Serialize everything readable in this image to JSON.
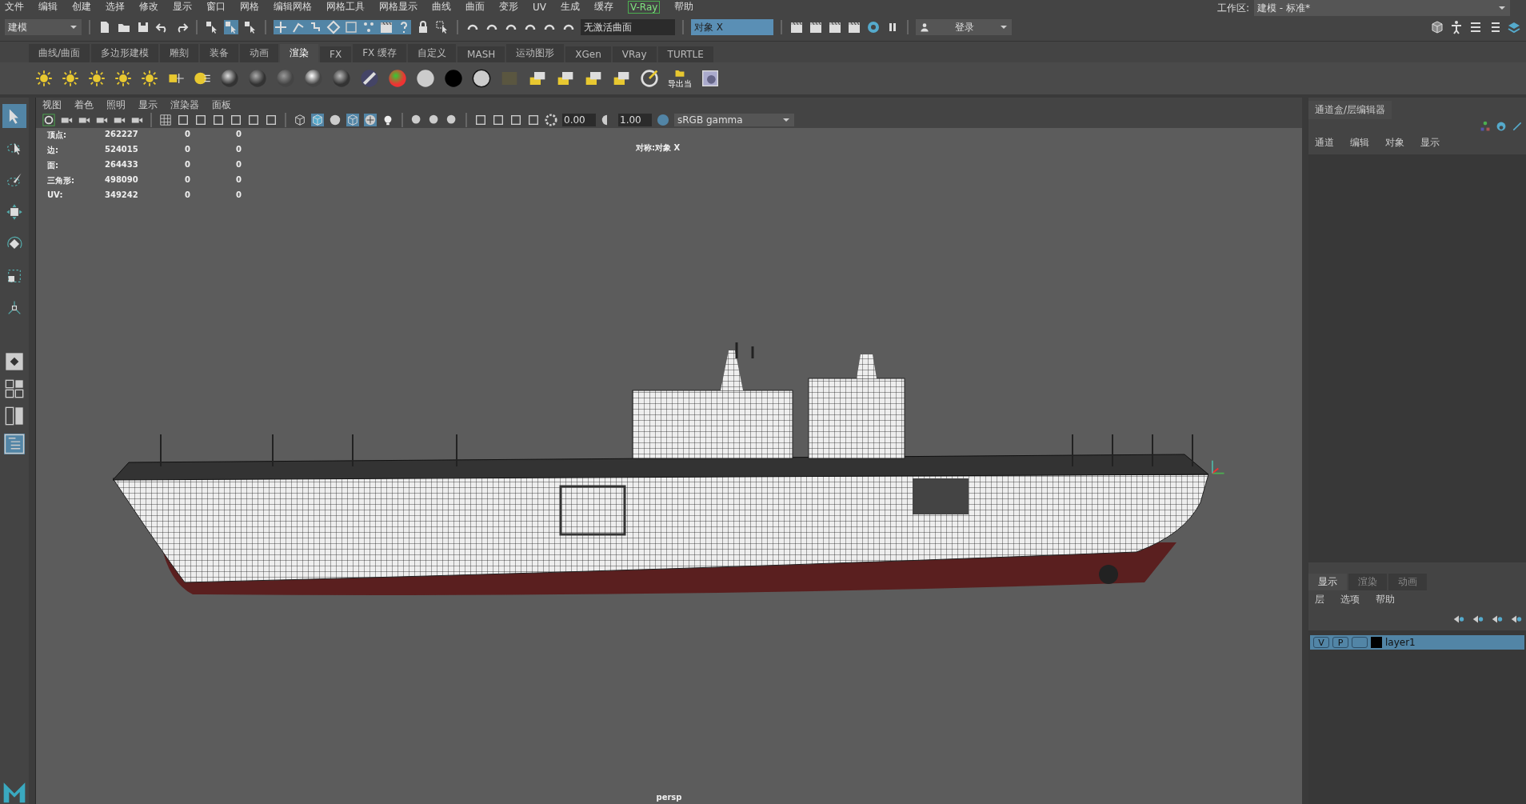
{
  "menu_bar": [
    {
      "label": "文件",
      "highlighted": false
    },
    {
      "label": "编辑",
      "highlighted": false
    },
    {
      "label": "创建",
      "highlighted": false
    },
    {
      "label": "选择",
      "highlighted": false
    },
    {
      "label": "修改",
      "highlighted": false
    },
    {
      "label": "显示",
      "highlighted": false
    },
    {
      "label": "窗口",
      "highlighted": false
    },
    {
      "label": "网格",
      "highlighted": false
    },
    {
      "label": "编辑网格",
      "highlighted": false
    },
    {
      "label": "网格工具",
      "highlighted": false
    },
    {
      "label": "网格显示",
      "highlighted": false
    },
    {
      "label": "曲线",
      "highlighted": false
    },
    {
      "label": "曲面",
      "highlighted": false
    },
    {
      "label": "变形",
      "highlighted": false
    },
    {
      "label": "UV",
      "highlighted": false
    },
    {
      "label": "生成",
      "highlighted": false
    },
    {
      "label": "缓存",
      "highlighted": false
    },
    {
      "label": "V-Ray",
      "highlighted": true
    },
    {
      "label": "帮助",
      "highlighted": false
    }
  ],
  "status_line": {
    "mode": "建模",
    "input_field": "无激活曲面",
    "symmetry": "对象 X",
    "login": "登录",
    "workspace_label": "工作区:",
    "workspace": "建模 - 标准*"
  },
  "shelf": {
    "tabs": [
      {
        "label": "曲线/曲面",
        "selected": false
      },
      {
        "label": "多边形建模",
        "selected": false
      },
      {
        "label": "雕刻",
        "selected": false
      },
      {
        "label": "装备",
        "selected": false
      },
      {
        "label": "动画",
        "selected": false
      },
      {
        "label": "渲染",
        "selected": true
      },
      {
        "label": "FX",
        "selected": false
      },
      {
        "label": "FX 缓存",
        "selected": false
      },
      {
        "label": "自定义",
        "selected": false
      },
      {
        "label": "MASH",
        "selected": false
      },
      {
        "label": "运动图形",
        "selected": false
      },
      {
        "label": "XGen",
        "selected": false
      },
      {
        "label": "VRay",
        "selected": false
      },
      {
        "label": "TURTLE",
        "selected": false
      }
    ],
    "export_button": "导出当"
  },
  "toolbox": [
    {
      "kind": "select",
      "selected": true
    },
    {
      "kind": "lasso",
      "selected": false
    },
    {
      "kind": "paint",
      "selected": false
    },
    {
      "kind": "move",
      "selected": false
    },
    {
      "kind": "rotate",
      "selected": false
    },
    {
      "kind": "scale",
      "selected": false
    },
    {
      "kind": "pivot",
      "selected": false
    }
  ],
  "viewport": {
    "menu": [
      "视图",
      "着色",
      "照明",
      "显示",
      "渲染器",
      "面板"
    ],
    "exposure": "0.00",
    "gamma": "1.00",
    "color_space": "sRGB gamma",
    "hud": [
      {
        "label": "顶点:",
        "values": [
          "262227",
          "0",
          "0"
        ]
      },
      {
        "label": "边:",
        "values": [
          "524015",
          "0",
          "0"
        ]
      },
      {
        "label": "面:",
        "values": [
          "264433",
          "0",
          "0"
        ]
      },
      {
        "label": "三角形:",
        "values": [
          "498090",
          "0",
          "0"
        ]
      },
      {
        "label": "UV:",
        "values": [
          "349242",
          "0",
          "0"
        ]
      }
    ],
    "symmetry_hud": "对称:对象 X",
    "camera": "persp"
  },
  "channel_box": {
    "title": "通道盒/层编辑器",
    "menu": [
      "通道",
      "编辑",
      "对象",
      "显示"
    ]
  },
  "layer_editor": {
    "tabs": [
      {
        "label": "显示",
        "selected": true
      },
      {
        "label": "渲染",
        "selected": false
      },
      {
        "label": "动画",
        "selected": false
      }
    ],
    "menu": [
      "层",
      "选项",
      "帮助"
    ],
    "layers": [
      {
        "visible": "V",
        "playback": "P",
        "color": "#000000",
        "name": "layer1",
        "selected": true
      }
    ]
  }
}
